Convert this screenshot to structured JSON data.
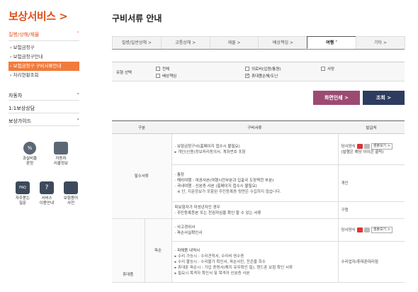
{
  "sidebar": {
    "title": "보상서비스 >",
    "section": "질병/상해/재물",
    "items": [
      "보험금청구",
      "보험금청구안내",
      "보험금청구 구비서류안내",
      "처리현황조회"
    ],
    "links": [
      "자동차",
      "1:1보상상담",
      "보상가이드"
    ],
    "quick_top": [
      {
        "icon": "percent-icon",
        "label1": "과실비율",
        "label2": "판정"
      },
      {
        "icon": "car-icon",
        "label1": "자동차",
        "label2": "리콜정보"
      }
    ],
    "quick_bottom": [
      {
        "icon": "faq-icon",
        "label1": "자주묻는",
        "label2": "질문"
      },
      {
        "icon": "question-icon",
        "label1": "서비스",
        "label2": "이용안내"
      },
      {
        "icon": "dictionary-icon",
        "label1": "보험용어",
        "label2": "사전"
      }
    ]
  },
  "page_title": "구비서류 안내",
  "tabs": [
    "질병/일반상해 >",
    "교통상해 >",
    "재물 >",
    "배상책임 >",
    "여행 ˅",
    "기타 >"
  ],
  "active_tab": 4,
  "filter": {
    "label": "유형 선택",
    "options": [
      {
        "label": "전체",
        "checked": false
      },
      {
        "label": "의료비(입원/통원)",
        "checked": false
      },
      {
        "label": "사망",
        "checked": false
      },
      {
        "label": "배상책임",
        "checked": false
      },
      {
        "label": "휴대품손해/도난",
        "checked": true
      }
    ]
  },
  "buttons": {
    "print": "화면인쇄 >",
    "query": "조회 >"
  },
  "table": {
    "headers": [
      "구분",
      "구비서류",
      "발급처"
    ],
    "required_label": "필수서류",
    "portable_label": "휴대품",
    "damage_label": "파손",
    "rows": {
      "r1_lines": [
        "보험금청구서(홈페이지 접수시 불필요)",
        "개인(신용)정보처리동의서, 계좌번호 포함"
      ],
      "r1_issuer": "당사양식",
      "r1_note": "(발행은 해당 아이콘 클릭)",
      "r2_lines": [
        "통장",
        "해외여행 : 여권사본(여행시전부분과 입출국 도장찍힌 부분)",
        "국내여행 : 신분증 사본 (홈페이지 접수시 불필요)",
        "※ 단, 지문정보가 포함된 주민등록증 뒷면은 수집하지 않습니다."
      ],
      "r2_issuer": "개인",
      "r3_lines": [
        "피보험자가 미성년자인 경우",
        "주민등록등본 또는 친권자임을 확인 할 수 있는 서류"
      ],
      "r3_issuer": "구청",
      "r4_lines": [
        "사고경위서",
        "파손사실확인서"
      ],
      "r4_issuer": "당사양식",
      "r5_lines": [
        "피해품 내역서",
        "수리 가능시 : 수리견적서, 수리비 영수증",
        "수리 불능시 : 수리불가 확인서, 파손사진, 잔존물 회수",
        "휴대폰 파손시 : 가입 증명서(해지 유무확인 필), 핸드폰 보험 확인 서류",
        "필요시 목격자 확인서 및 목격자 신분증 사본"
      ],
      "r5_issuer": "수리업자/휴대폰대리점",
      "sample_label": "샘플보기 >"
    }
  }
}
